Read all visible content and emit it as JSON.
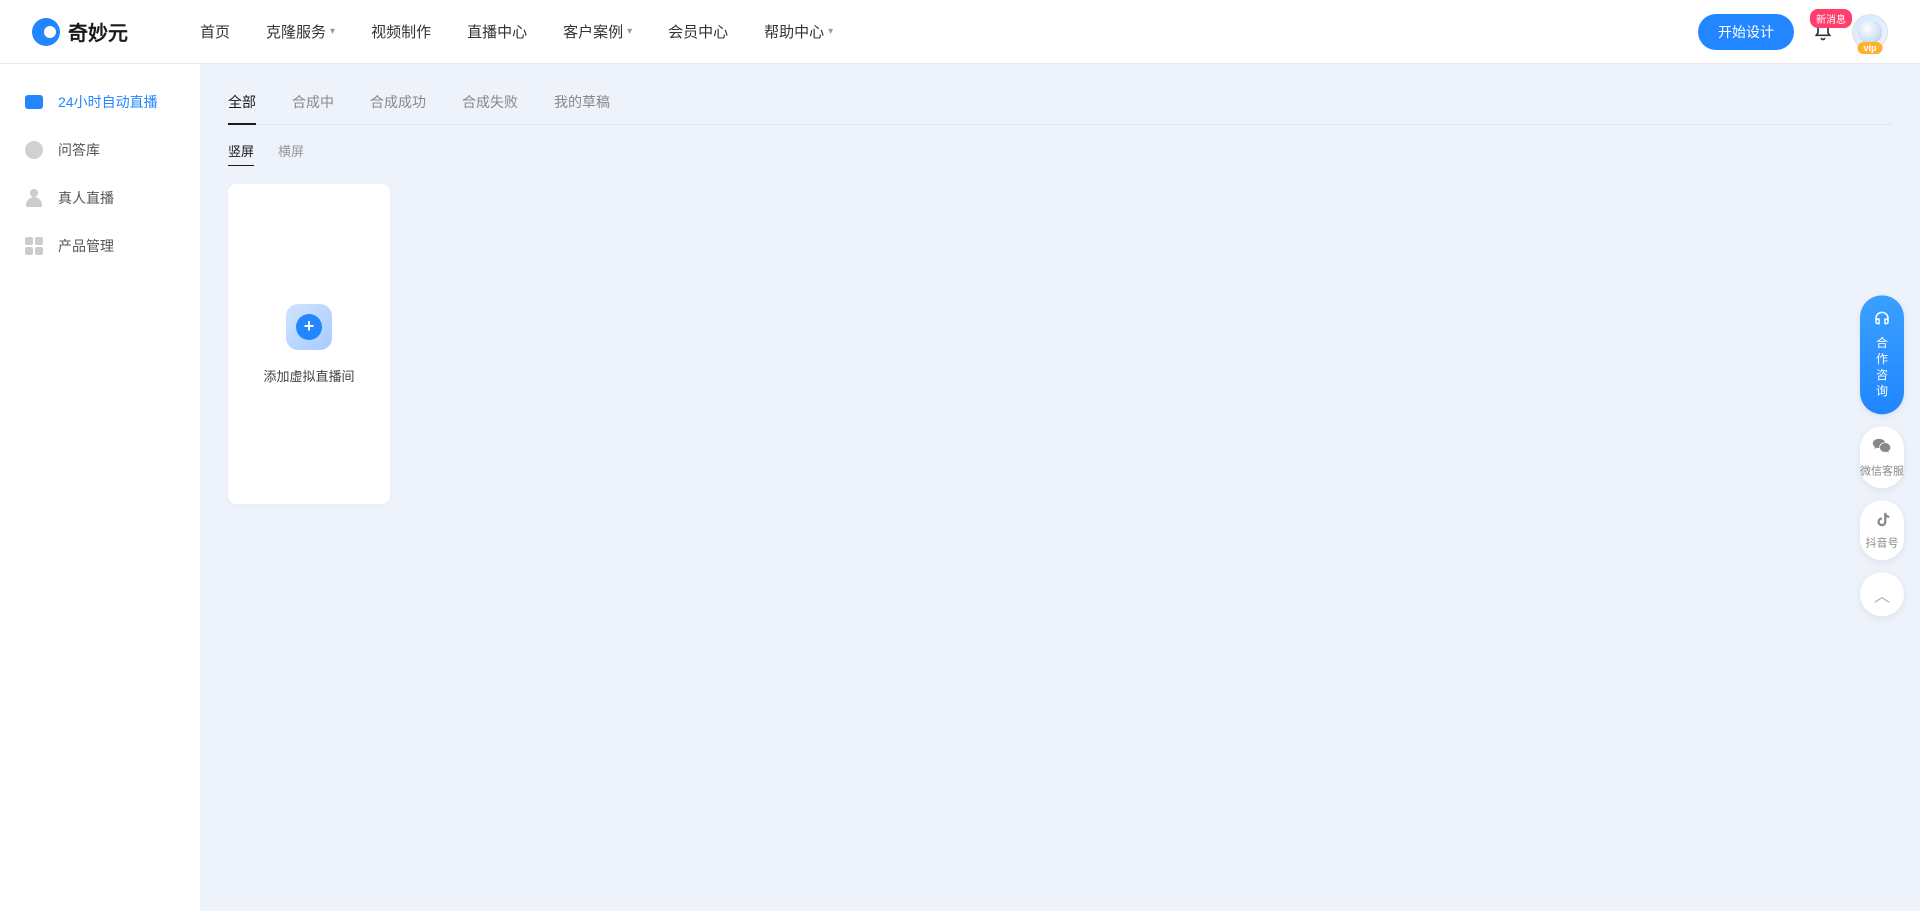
{
  "header": {
    "logo_text": "奇妙元",
    "nav": [
      {
        "label": "首页",
        "dropdown": false
      },
      {
        "label": "克隆服务",
        "dropdown": true
      },
      {
        "label": "视频制作",
        "dropdown": false
      },
      {
        "label": "直播中心",
        "dropdown": false
      },
      {
        "label": "客户案例",
        "dropdown": true
      },
      {
        "label": "会员中心",
        "dropdown": false
      },
      {
        "label": "帮助中心",
        "dropdown": true
      }
    ],
    "start_button": "开始设计",
    "notif_badge": "新消息",
    "vip_badge": "vip"
  },
  "sidebar": {
    "items": [
      {
        "label": "24小时自动直播",
        "active": true
      },
      {
        "label": "问答库",
        "active": false
      },
      {
        "label": "真人直播",
        "active": false
      },
      {
        "label": "产品管理",
        "active": false
      }
    ]
  },
  "main": {
    "tabs": [
      {
        "label": "全部",
        "active": true
      },
      {
        "label": "合成中",
        "active": false
      },
      {
        "label": "合成成功",
        "active": false
      },
      {
        "label": "合成失败",
        "active": false
      },
      {
        "label": "我的草稿",
        "active": false
      }
    ],
    "subtabs": [
      {
        "label": "竖屏",
        "active": true
      },
      {
        "label": "横屏",
        "active": false
      }
    ],
    "add_card_label": "添加虚拟直播间"
  },
  "float": {
    "consult": "合作咨询",
    "wechat": "微信客服",
    "douyin": "抖音号"
  }
}
